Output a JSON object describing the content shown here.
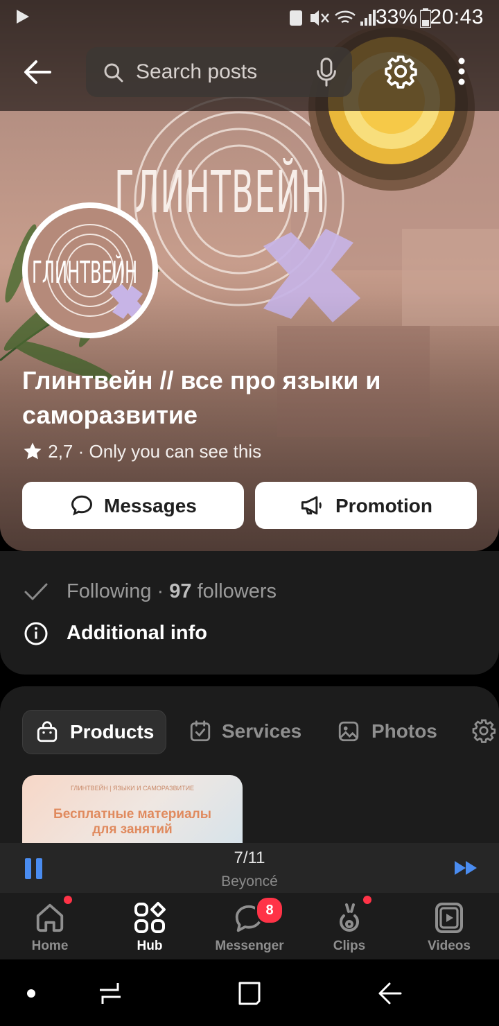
{
  "status_bar": {
    "battery": "33%",
    "time": "20:43"
  },
  "top_bar": {
    "search_placeholder": "Search posts"
  },
  "cover": {
    "logo_text": "ГЛИНТВЕЙН"
  },
  "community": {
    "name": "Глинтвейн // все про языки и саморазвитие",
    "rating": "2,7",
    "visibility": "· Only you can see this"
  },
  "actions": {
    "messages": "Messages",
    "promotion": "Promotion"
  },
  "info": {
    "following": "Following ·",
    "followers_count": "97",
    "followers_word": "followers",
    "additional": "Additional info"
  },
  "tabs": [
    {
      "label": "Products",
      "icon": "bag-icon"
    },
    {
      "label": "Services",
      "icon": "calendar-check-icon"
    },
    {
      "label": "Photos",
      "icon": "image-icon"
    }
  ],
  "product_card": {
    "caption": "ГЛИНТВЕЙН | ЯЗЫКИ И САМОРАЗВИТИЕ",
    "title_line1": "Бесплатные материалы",
    "title_line2": "для занятий"
  },
  "player": {
    "track": "7/11",
    "artist": "Beyoncé"
  },
  "bottom_nav": [
    {
      "label": "Home",
      "icon": "home-icon"
    },
    {
      "label": "Hub",
      "icon": "hub-icon"
    },
    {
      "label": "Messenger",
      "icon": "messenger-icon",
      "badge": "8"
    },
    {
      "label": "Clips",
      "icon": "clips-icon"
    },
    {
      "label": "Videos",
      "icon": "videos-icon"
    }
  ],
  "colors": {
    "accent": "#4a8cf0",
    "badge": "#ff3347",
    "card": "#1c1c1c"
  }
}
